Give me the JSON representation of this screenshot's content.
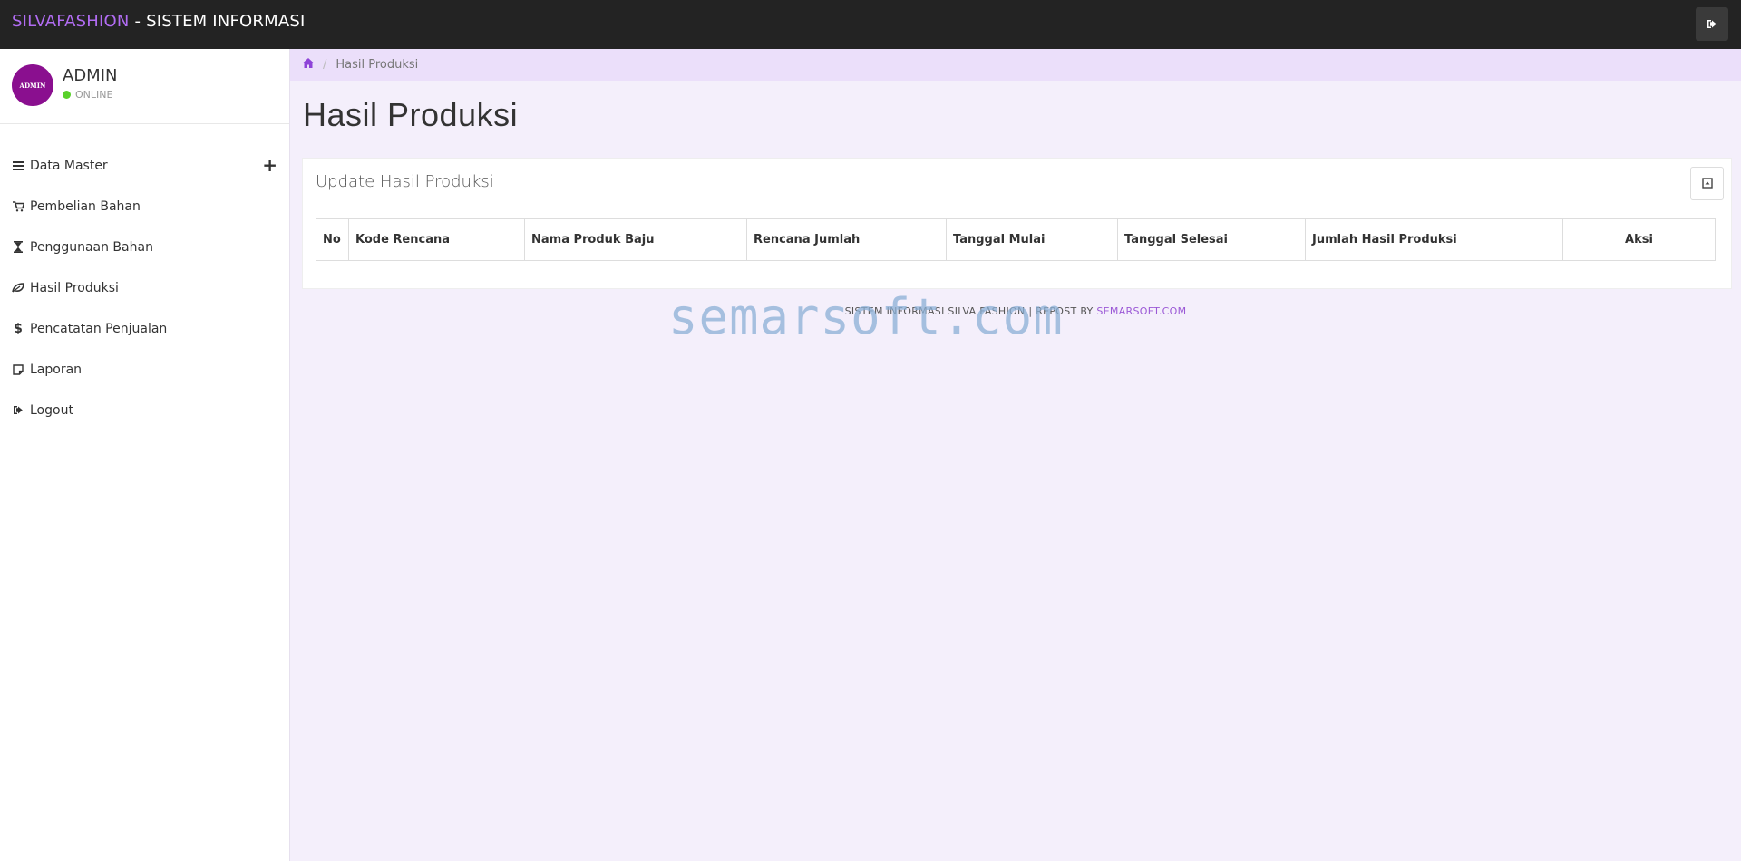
{
  "header": {
    "brand_accent": "SILVAFASHION",
    "brand_rest": " - SISTEM INFORMASI",
    "logout_icon": "sign-out-icon"
  },
  "user": {
    "avatar_text": "ADMIN",
    "name": "ADMIN",
    "status": "ONLINE"
  },
  "sidebar": {
    "items": [
      {
        "label": "Data Master",
        "icon": "bars-icon",
        "expandable": true,
        "expand_symbol": "+"
      },
      {
        "label": "Pembelian Bahan",
        "icon": "cart-icon"
      },
      {
        "label": "Penggunaan Bahan",
        "icon": "hourglass-icon"
      },
      {
        "label": "Hasil Produksi",
        "icon": "leaf-icon"
      },
      {
        "label": "Pencatatan Penjualan",
        "icon": "dollar-icon"
      },
      {
        "label": "Laporan",
        "icon": "note-icon"
      },
      {
        "label": "Logout",
        "icon": "sign-out-icon"
      }
    ]
  },
  "breadcrumb": {
    "home_icon": "home-icon",
    "current": "Hasil Produksi"
  },
  "page": {
    "title": "Hasil Produksi"
  },
  "panel": {
    "title": "Update Hasil Produksi",
    "button_icon": "minimize-icon"
  },
  "table": {
    "headers": [
      "No",
      "Kode Rencana",
      "Nama Produk Baju",
      "Rencana Jumlah",
      "Tanggal Mulai",
      "Tanggal Selesai",
      "Jumlah Hasil Produksi",
      "Aksi"
    ],
    "rows": []
  },
  "footer": {
    "text": "SISTEM INFORMASI SILVA FASHION | REPOST BY ",
    "link": "SEMARSOFT.COM"
  },
  "watermark": "semarsoft.com",
  "colors": {
    "accent": "#b16cf2",
    "navbar": "#232323",
    "background": "#f4effb",
    "breadcrumb_bg": "#ebdffa",
    "avatar": "#8a0f8f",
    "online": "#5ad12b"
  }
}
